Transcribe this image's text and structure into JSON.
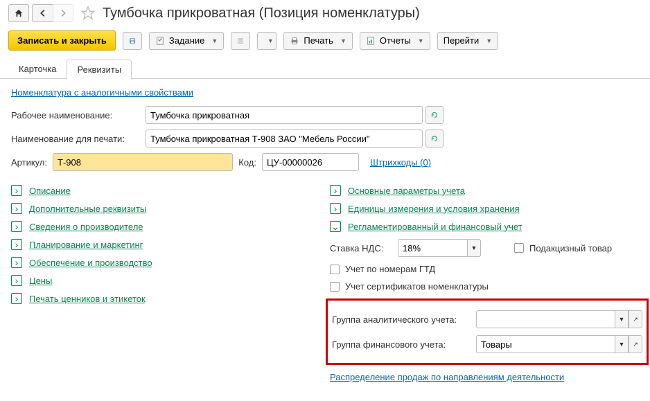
{
  "header": {
    "title": "Тумбочка прикроватная (Позиция номенклатуры)"
  },
  "toolbar": {
    "save_close": "Записать и закрыть",
    "task": "Задание",
    "print": "Печать",
    "reports": "Отчеты",
    "goto": "Перейти"
  },
  "tabs": {
    "card": "Карточка",
    "props": "Реквизиты"
  },
  "links": {
    "similar": "Номенклатура с аналогичными свойствами",
    "barcodes": "Штрихкоды (0)",
    "distribution": "Распределение продаж по направлениям деятельности"
  },
  "form": {
    "work_name_label": "Рабочее наименование:",
    "work_name_value": "Тумбочка прикроватная",
    "print_name_label": "Наименование для печати:",
    "print_name_value": "Тумбочка прикроватная Т-908 ЗАО \"Мебель России\"",
    "article_label": "Артикул:",
    "article_value": "Т-908",
    "code_label": "Код:",
    "code_value": "ЦУ-00000026"
  },
  "left_items": {
    "desc": "Описание",
    "extra": "Дополнительные реквизиты",
    "manuf": "Сведения о производителе",
    "plan": "Планирование и маркетинг",
    "supply": "Обеспечение и производство",
    "prices": "Цены",
    "labels": "Печать ценников и этикеток"
  },
  "right_items": {
    "main": "Основные параметры учета",
    "units": "Единицы измерения и условия хранения",
    "reg": "Регламентированный и финансовый учет"
  },
  "right_form": {
    "vat_label": "Ставка НДС:",
    "vat_value": "18%",
    "excise": "Подакцизный товар",
    "gtd": "Учет по номерам ГТД",
    "cert": "Учет сертификатов номенклатуры",
    "analytic_label": "Группа аналитического учета:",
    "analytic_value": "",
    "fin_label": "Группа финансового учета:",
    "fin_value": "Товары"
  }
}
